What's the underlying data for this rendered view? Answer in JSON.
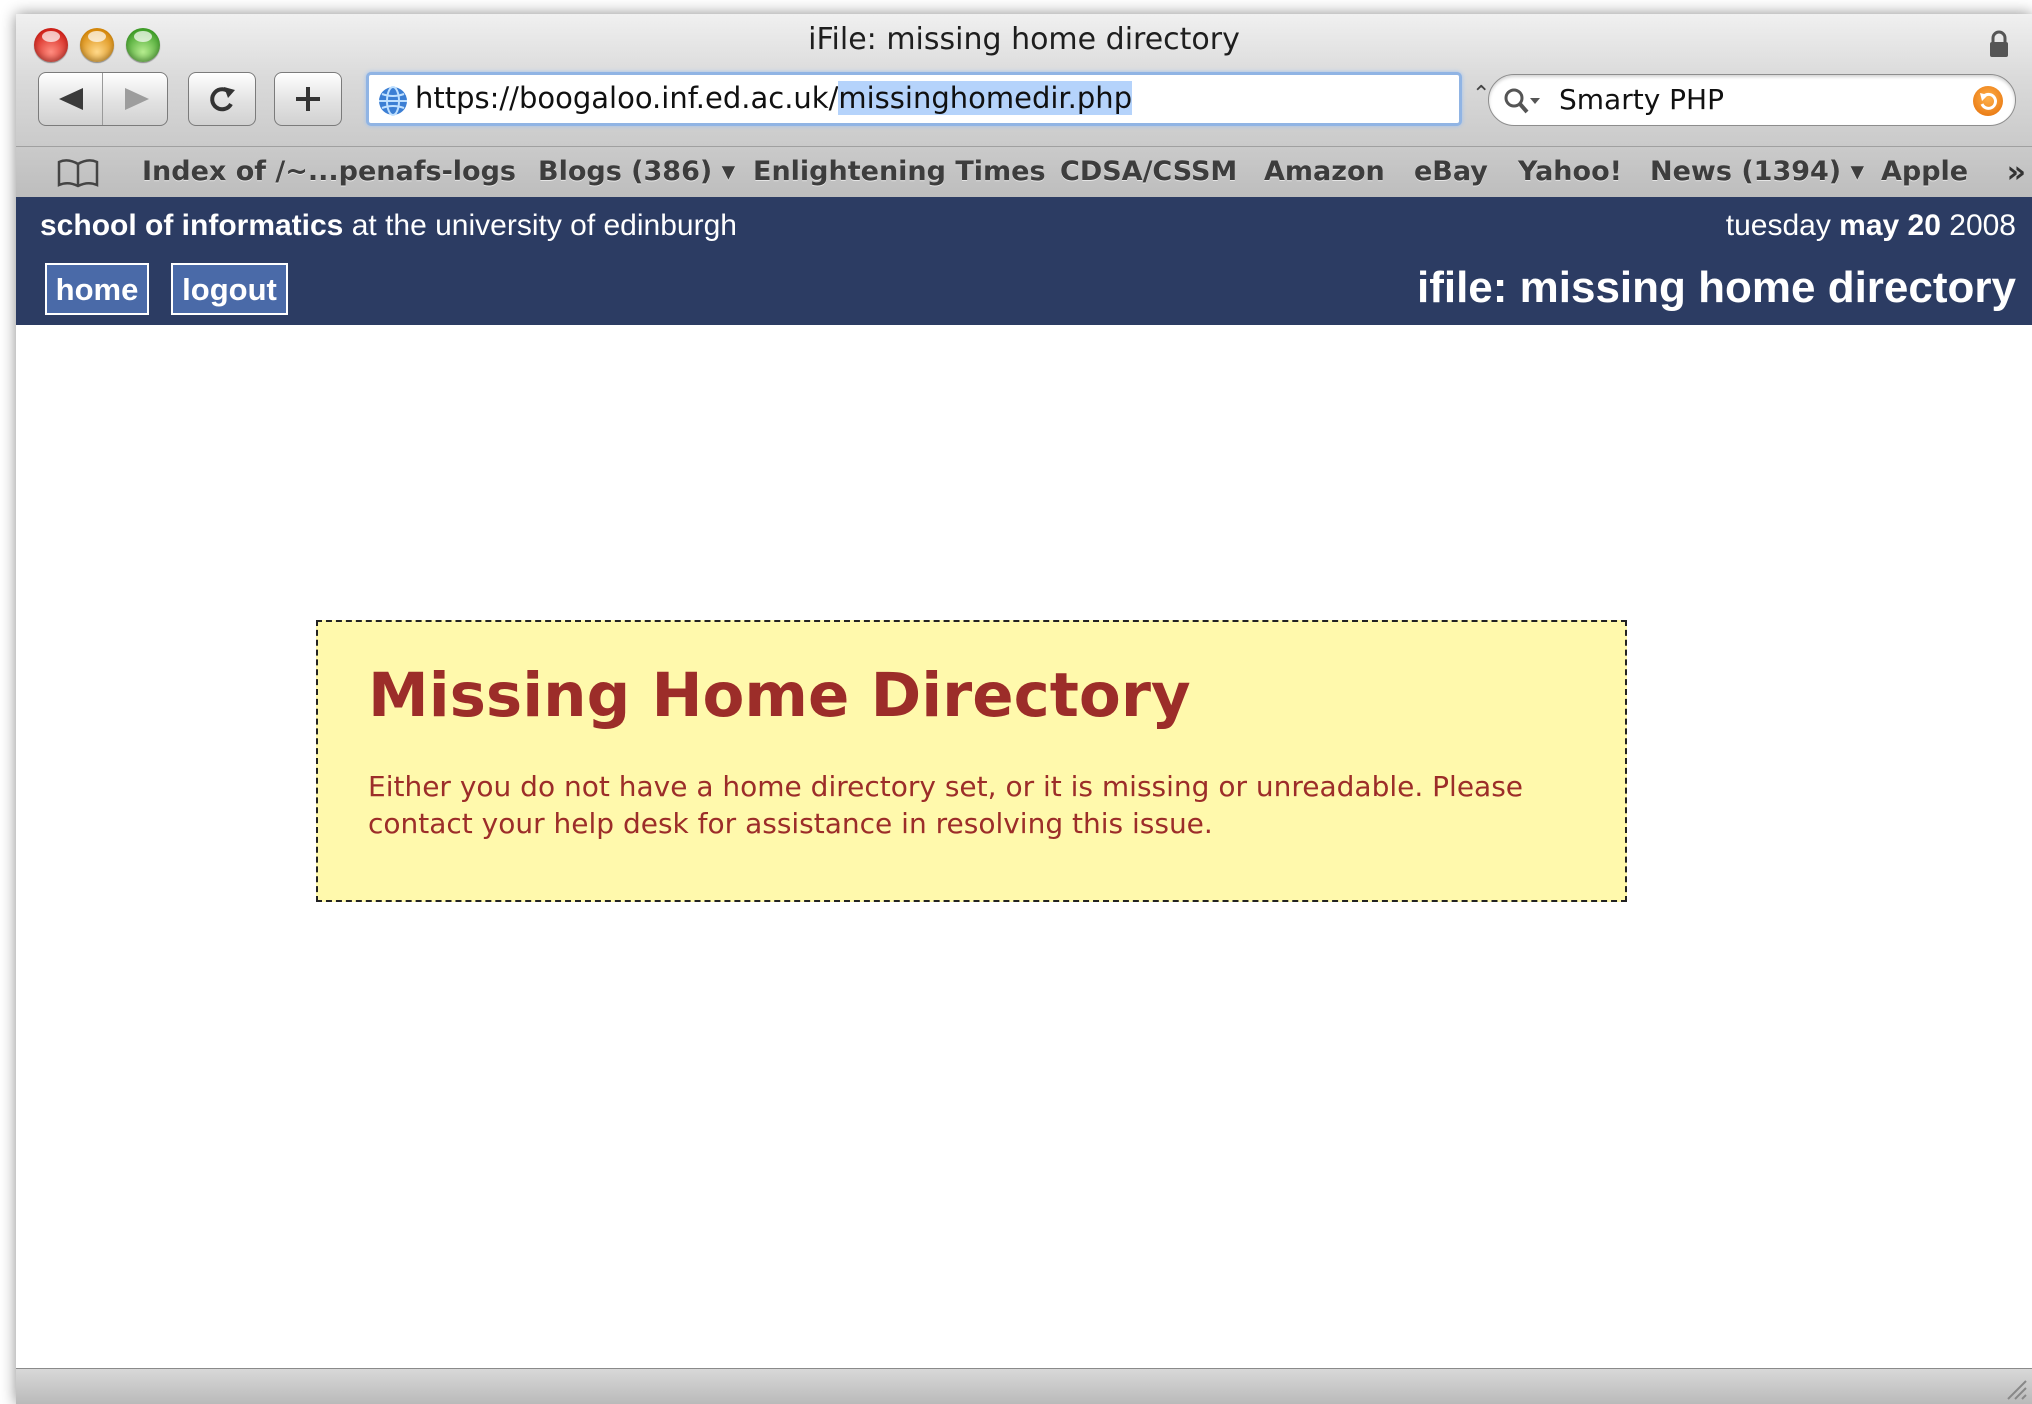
{
  "window": {
    "title": "iFile: missing home directory"
  },
  "toolbar": {
    "url_prefix": "https://boogaloo.inf.ed.ac.uk/",
    "url_selected": "missinghomedir.php",
    "search_value": "Smarty PHP"
  },
  "bookmarks": [
    {
      "label": "Index of /~...penafs-logs"
    },
    {
      "label": "Blogs (386) ▾"
    },
    {
      "label": "Enlightening Times"
    },
    {
      "label": "CDSA/CSSM"
    },
    {
      "label": "Amazon"
    },
    {
      "label": "eBay"
    },
    {
      "label": "Yahoo!"
    },
    {
      "label": "News (1394) ▾"
    },
    {
      "label": "Apple"
    }
  ],
  "site": {
    "school_bold": "school of informatics",
    "school_rest": " at the university of edinburgh",
    "date_day": "tuesday ",
    "date_bold": "may 20",
    "date_year": " 2008",
    "nav_home": "home",
    "nav_logout": "logout",
    "page_heading": "ifile: missing home directory"
  },
  "notice": {
    "heading": "Missing Home Directory",
    "message": "Either you do not have a home directory set, or it is missing or unreadable. Please contact your help desk for assistance in resolving this issue."
  },
  "colors": {
    "header_bg": "#2c3c63",
    "notice_bg": "#fff9ac",
    "notice_text": "#9c2d29",
    "nav_button_bg": "#4a6aa8"
  }
}
